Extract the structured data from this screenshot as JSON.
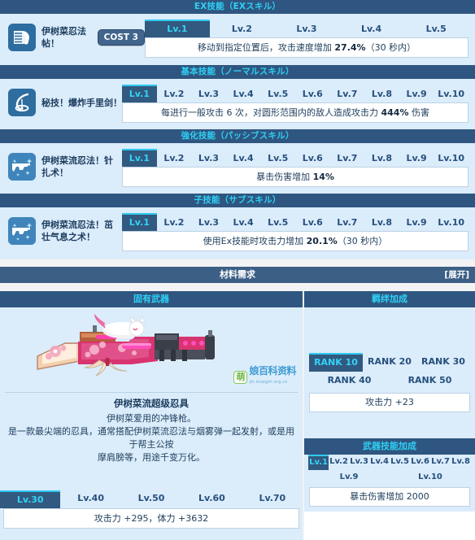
{
  "sections": {
    "ex": {
      "title": "EX技能（EXスキル）"
    },
    "normal": {
      "title": "基本技能（ノーマルスキル）"
    },
    "passive": {
      "title": "強化技能（パッシブスキル）"
    },
    "sub": {
      "title": "子技能（サブスキル）"
    }
  },
  "skills": [
    {
      "icon": "scroll-icon",
      "name": "伊树菜忍法帖！",
      "cost": "COST 3",
      "levels": [
        "Lv.1",
        "Lv.2",
        "Lv.3",
        "Lv.4",
        "Lv.5"
      ],
      "active_level": "Lv.1",
      "desc_pre": "移动到指定位置后，攻击速度增加 ",
      "desc_value": "27.4%",
      "desc_post": "（30 秒内）"
    },
    {
      "icon": "shuriken-icon",
      "name": "秘技！爆炸手里剑！",
      "cost": "",
      "levels": [
        "Lv.1",
        "Lv.2",
        "Lv.3",
        "Lv.4",
        "Lv.5",
        "Lv.6",
        "Lv.7",
        "Lv.8",
        "Lv.9",
        "Lv.10"
      ],
      "active_level": "Lv.1",
      "desc_pre": "每进行一般攻击 6 次，对圆形范围内的敌人造成攻击力 ",
      "desc_value": "444%",
      "desc_post": " 伤害"
    },
    {
      "icon": "gun-icon",
      "name": "伊树菜流忍法！针扎术！",
      "cost": "",
      "levels": [
        "Lv.1",
        "Lv.2",
        "Lv.3",
        "Lv.4",
        "Lv.5",
        "Lv.6",
        "Lv.7",
        "Lv.8",
        "Lv.9",
        "Lv.10"
      ],
      "active_level": "Lv.1",
      "desc_pre": "暴击伤害增加 ",
      "desc_value": "14%",
      "desc_post": ""
    },
    {
      "icon": "gun-icon",
      "name": "伊树菜流忍法！茁壮气息之术！",
      "cost": "",
      "levels": [
        "Lv.1",
        "Lv.2",
        "Lv.3",
        "Lv.4",
        "Lv.5",
        "Lv.6",
        "Lv.7",
        "Lv.8",
        "Lv.9",
        "Lv.10"
      ],
      "active_level": "Lv.1",
      "desc_pre": "使用Ex技能时攻击力增加 ",
      "desc_value": "20.1%",
      "desc_post": "（30 秒内）"
    }
  ],
  "material": {
    "title": "材料需求",
    "expand_label": "[展开]"
  },
  "weapon": {
    "panel_title": "固有武器",
    "name": "伊树菜流超级忍具",
    "desc_line1": "伊树菜爱用的冲锋枪。",
    "desc_line2": "是一款最尖端的忍具，通常搭配伊树菜流忍法与烟雾弹一起发射，或是用于帮主公按",
    "desc_line3": "摩肩膀等，用途千变万化。",
    "levels": [
      "Lv.30",
      "Lv.40",
      "Lv.50",
      "Lv.60",
      "Lv.70"
    ],
    "active_level": "Lv.30",
    "stat_text": "攻击力 +295，体力 +3632",
    "watermark": {
      "badge": "萌",
      "text": "娘百科资料",
      "sub": "zh.moegirl.org.cn"
    }
  },
  "bond": {
    "panel_title": "羁绊加成",
    "ranks": [
      "RANK 10",
      "RANK 20",
      "RANK 30",
      "RANK 40",
      "RANK 50"
    ],
    "active_rank": "RANK 10",
    "effect": "攻击力 +23"
  },
  "weapon_skill": {
    "panel_title": "武器技能加成",
    "levels": [
      "Lv.1",
      "Lv.2",
      "Lv.3",
      "Lv.4",
      "Lv.5",
      "Lv.6",
      "Lv.7",
      "Lv.8",
      "Lv.9",
      "Lv.10"
    ],
    "active_level": "Lv.1",
    "effect": "暴击伤害增加 2000"
  },
  "colors": {
    "header_bar": "#2f5680",
    "panel_bg": "#dbecfb",
    "accent_cyan": "#2fd0f5",
    "active_tab_bg": "#32597f"
  }
}
